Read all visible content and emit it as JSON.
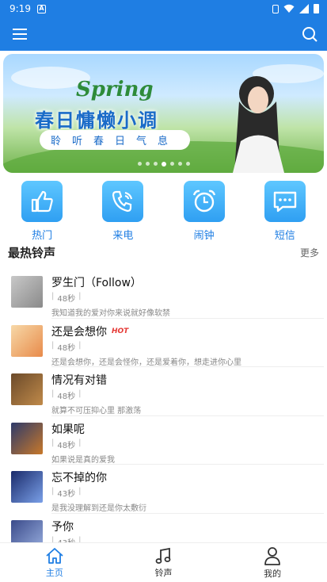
{
  "status": {
    "time": "9:19"
  },
  "banner": {
    "title_en": "Spring",
    "title_cn": "春日慵懒小调",
    "subtitle": "聆听春日气息",
    "dot_count": 7,
    "active_dot": 3
  },
  "categories": [
    {
      "label": "热门",
      "icon": "thumbs-up-icon"
    },
    {
      "label": "来电",
      "icon": "phone-icon"
    },
    {
      "label": "闹钟",
      "icon": "alarm-clock-icon"
    },
    {
      "label": "短信",
      "icon": "chat-bubble-icon"
    }
  ],
  "section": {
    "title": "最热铃声",
    "more": "更多"
  },
  "songs": [
    {
      "name": "罗生门（Follow）",
      "duration": "48秒",
      "desc": "我知道我的爱对你来说就好像软禁",
      "hot": "",
      "colors": [
        "#c8c8c8",
        "#8a8a8a"
      ]
    },
    {
      "name": "还是会想你",
      "duration": "48秒",
      "desc": "还是会想你，还是会怪你，还是爱着你，想走进你心里",
      "hot": "HOT",
      "colors": [
        "#f7d9a8",
        "#e88a4a"
      ]
    },
    {
      "name": "情况有对错",
      "duration": "48秒",
      "desc": "就算不可压抑心里 那激荡",
      "hot": "",
      "colors": [
        "#6b4a2a",
        "#c08a4a"
      ]
    },
    {
      "name": "如果呢",
      "duration": "48秒",
      "desc": "如果说是真的爱我",
      "hot": "",
      "colors": [
        "#2d3a6a",
        "#c8782a"
      ]
    },
    {
      "name": "忘不掉的你",
      "duration": "43秒",
      "desc": "是我没理解到还是你太敷衍",
      "hot": "",
      "colors": [
        "#1a2a6a",
        "#7aa0e8"
      ]
    },
    {
      "name": "予你",
      "duration": "43秒",
      "desc": "",
      "hot": "",
      "colors": [
        "#3a4a8a",
        "#9ab0e0"
      ]
    }
  ],
  "tabs": [
    {
      "label": "主页",
      "icon": "home-icon",
      "active": true
    },
    {
      "label": "铃声",
      "icon": "music-note-icon",
      "active": false
    },
    {
      "label": "我的",
      "icon": "user-icon",
      "active": false
    }
  ],
  "colors": {
    "primary": "#1f7ee3",
    "hot": "#e53935"
  }
}
